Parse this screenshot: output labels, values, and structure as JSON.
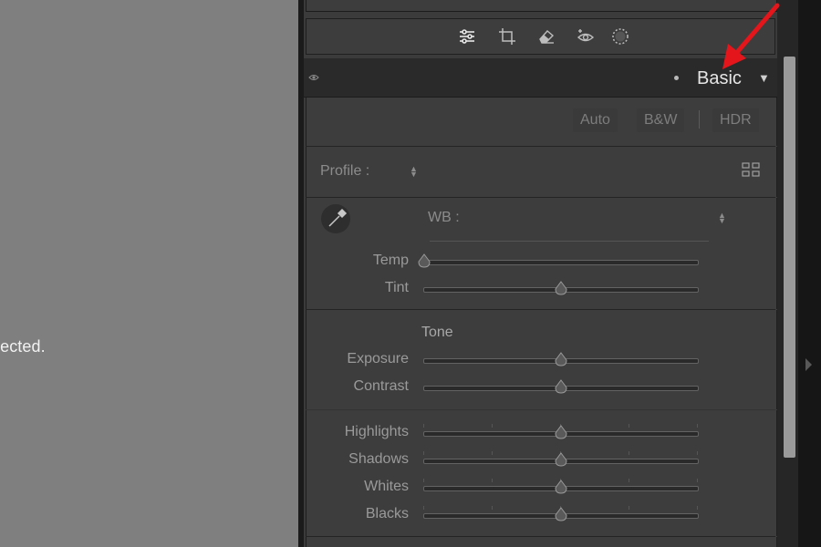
{
  "canvas": {
    "message": "lected."
  },
  "toolbar": {
    "tools": [
      {
        "icon": "edit-sliders-icon"
      },
      {
        "icon": "crop-icon"
      },
      {
        "icon": "healing-eraser-icon"
      },
      {
        "icon": "red-eye-icon"
      },
      {
        "icon": "masking-icon"
      }
    ]
  },
  "panel": {
    "title": "Basic",
    "treatment": {
      "auto": "Auto",
      "bw": "B&W",
      "hdr": "HDR"
    },
    "profile": {
      "label": "Profile :"
    },
    "wb": {
      "label": "WB :"
    },
    "wb_sliders": [
      {
        "label": "Temp",
        "value": 0.0
      },
      {
        "label": "Tint",
        "value": 0.5
      }
    ],
    "tone": {
      "title": "Tone",
      "sliders": [
        {
          "label": "Exposure",
          "value": 0.5
        },
        {
          "label": "Contrast",
          "value": 0.5
        }
      ]
    },
    "presence": {
      "sliders": [
        {
          "label": "Highlights",
          "value": 0.5
        },
        {
          "label": "Shadows",
          "value": 0.5
        },
        {
          "label": "Whites",
          "value": 0.5
        },
        {
          "label": "Blacks",
          "value": 0.5
        }
      ]
    }
  },
  "colors": {
    "canvas_bg": "#7f7f7f",
    "panel_bg": "#3b3b3b",
    "header_bg": "#2a2a2a",
    "annotation_arrow": "#e4161b"
  }
}
